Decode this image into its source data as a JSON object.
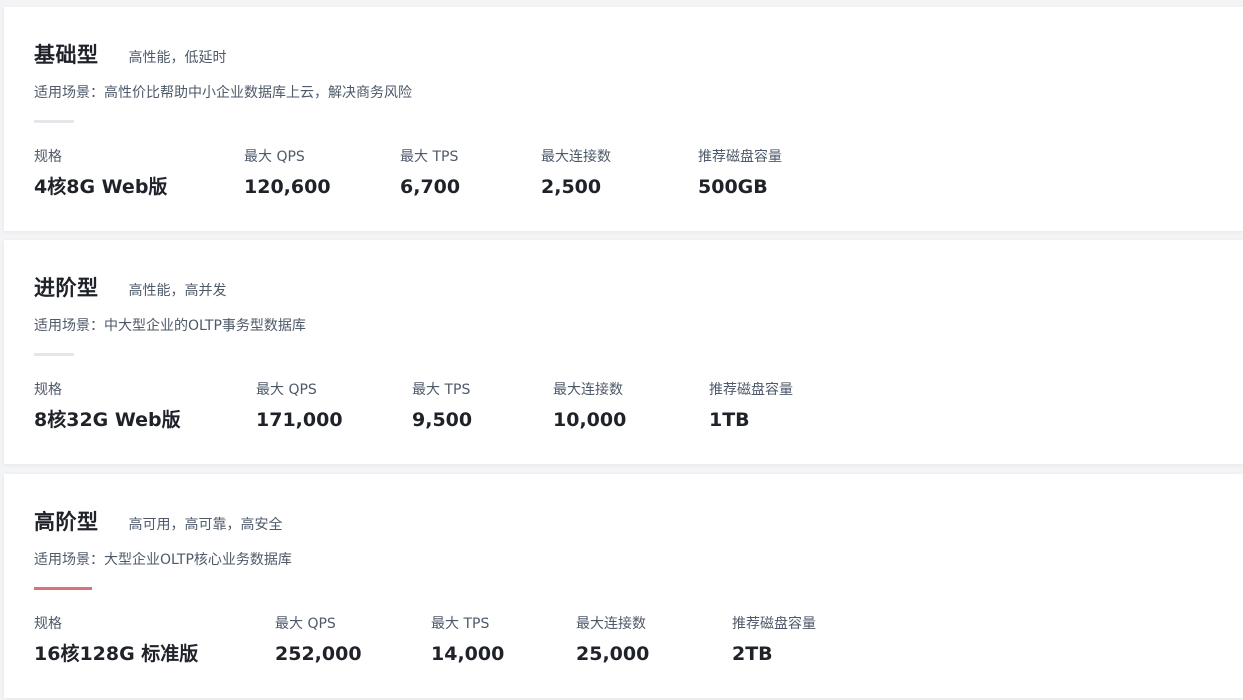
{
  "labels": {
    "spec": "规格",
    "qps": "最大 QPS",
    "tps": "最大 TPS",
    "connections": "最大连接数",
    "disk": "推荐磁盘容量",
    "scene_prefix": "适用场景："
  },
  "tiers": [
    {
      "title": "基础型",
      "tagline": "高性能，低延时",
      "scene": "适用场景：高性价比帮助中小企业数据库上云，解决商务风险",
      "spec": "4核8G Web版",
      "qps": "120,600",
      "tps": "6,700",
      "connections": "2,500",
      "disk": "500GB"
    },
    {
      "title": "进阶型",
      "tagline": "高性能，高并发",
      "scene": "适用场景：中大型企业的OLTP事务型数据库",
      "spec": "8核32G Web版",
      "qps": "171,000",
      "tps": "9,500",
      "connections": "10,000",
      "disk": "1TB"
    },
    {
      "title": "高阶型",
      "tagline": "高可用，高可靠，高安全",
      "scene": "适用场景：大型企业OLTP核心业务数据库",
      "spec": "16核128G 标准版",
      "qps": "252,000",
      "tps": "14,000",
      "connections": "25,000",
      "disk": "2TB"
    }
  ],
  "colors": {
    "accent_bar": "#d9737a",
    "default_bar": "#e5e6eb"
  }
}
